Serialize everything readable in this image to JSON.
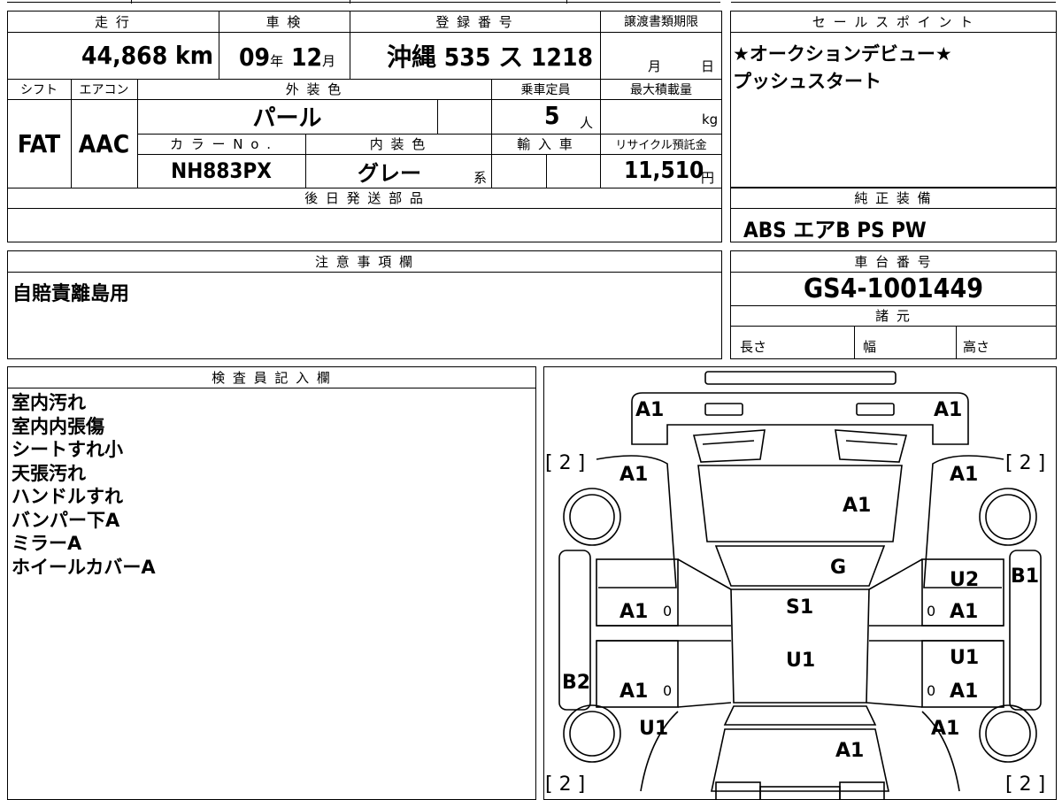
{
  "top_table": {
    "headers": {
      "mileage": "走 行",
      "inspection": "車 検",
      "registration": "登 録 番 号",
      "transfer_deadline": "譲渡書類期限",
      "shift": "シフト",
      "aircon": "エアコン",
      "exterior_color": "外 装 色",
      "capacity": "乗車定員",
      "max_load": "最大積載量",
      "color_no": "カ ラ ー N o .",
      "interior_color": "内 装 色",
      "import": "輸 入 車",
      "recycle": "リサイクル預託金",
      "later_parts": "後 日 発 送 部 品"
    },
    "values": {
      "mileage": "44,868 km",
      "inspection_year": "09",
      "inspection_year_unit": "年",
      "inspection_month": "12",
      "inspection_month_unit": "月",
      "registration": "沖縄 535 ス 1218",
      "transfer_month_unit": "月",
      "transfer_day_unit": "日",
      "shift": "FAT",
      "aircon": "AAC",
      "exterior_color": "パール",
      "capacity": "5",
      "capacity_unit": "人",
      "max_load_unit": "kg",
      "color_no": "NH883PX",
      "interior_color": "グレー",
      "interior_suffix": "系",
      "recycle": "11,510",
      "recycle_unit": "円"
    }
  },
  "sales_points": {
    "header": "セ ー ル ス ポ イ ン ト",
    "lines": [
      "★オークションデビュー★",
      "プッシュスタート"
    ]
  },
  "equipment": {
    "header": "純 正 装 備",
    "value": "ABS エアB PS PW"
  },
  "notes": {
    "header": "注 意 事 項 欄",
    "value": "自賠責離島用"
  },
  "chassis": {
    "header": "車 台 番 号",
    "value": "GS4-1001449"
  },
  "specs": {
    "header": "諸 元",
    "length": "長さ",
    "width": "幅",
    "height": "高さ"
  },
  "inspector": {
    "header": "検 査 員 記 入 欄",
    "lines": [
      "室内汚れ",
      "室内内張傷",
      "シートすれ小",
      "天張汚れ",
      "ハンドルすれ",
      "バンパー下A",
      "ミラーA",
      "ホイールカバーA"
    ]
  },
  "diagram": {
    "marks": {
      "front_left": "A1",
      "front_right": "A1",
      "tire_fl": "[ 2 ]",
      "tire_fr": "[ 2 ]",
      "fender_fl": "A1",
      "fender_fr": "A1",
      "hood": "A1",
      "windshield": "G",
      "rear_right_side": "B1",
      "door_fl": "A1",
      "door_fl_zero": "0",
      "door_fr_top": "U2",
      "door_fr": "A1",
      "door_fr_zero": "0",
      "roof_front": "S1",
      "roof_rear": "U1",
      "door_rl": "A1",
      "door_rl_zero": "0",
      "door_rr_top": "U1",
      "door_rr": "A1",
      "door_rr_zero": "0",
      "left_sill": "B2",
      "rear_left": "U1",
      "rear_right": "A1",
      "trunk": "A1",
      "tire_rl": "[ 2 ]",
      "tire_rr": "[ 2 ]"
    }
  }
}
